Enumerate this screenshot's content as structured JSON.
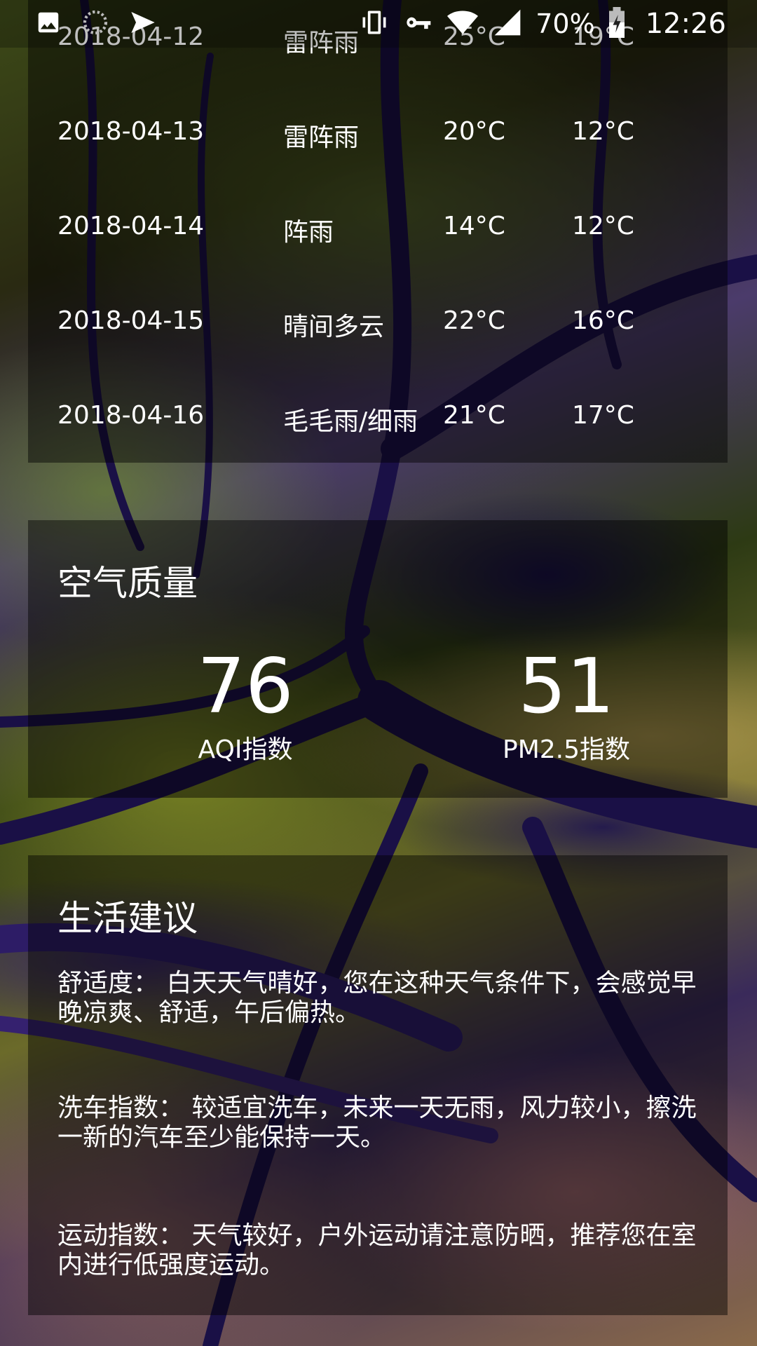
{
  "status_bar": {
    "battery": "70%",
    "time": "12:26",
    "icons": [
      "image-icon",
      "sync-icon",
      "send-icon",
      "vibrate-icon",
      "vpn-key-icon",
      "wifi-icon",
      "cell-signal-icon",
      "battery-charging-icon"
    ]
  },
  "forecast": {
    "rows": [
      {
        "date": "2018-04-12",
        "info": "雷阵雨",
        "max": "25°C",
        "min": "19°C"
      },
      {
        "date": "2018-04-13",
        "info": "雷阵雨",
        "max": "20°C",
        "min": "12°C"
      },
      {
        "date": "2018-04-14",
        "info": "阵雨",
        "max": "14°C",
        "min": "12°C"
      },
      {
        "date": "2018-04-15",
        "info": "晴间多云",
        "max": "22°C",
        "min": "16°C"
      },
      {
        "date": "2018-04-16",
        "info": "毛毛雨/细雨",
        "max": "21°C",
        "min": "17°C"
      }
    ]
  },
  "aqi": {
    "title": "空气质量",
    "aqi_value": "76",
    "aqi_label": "AQI指数",
    "pm25_value": "51",
    "pm25_label": "PM2.5指数"
  },
  "suggestion": {
    "title": "生活建议",
    "comfort": "舒适度： 白天天气晴好，您在这种天气条件下，会感觉早晚凉爽、舒适，午后偏热。",
    "car_wash": "洗车指数： 较适宜洗车，未来一天无雨，风力较小，擦洗一新的汽车至少能保持一天。",
    "sport": "运动指数： 天气较好，户外运动请注意防晒，推荐您在室内进行低强度运动。"
  },
  "colors": {
    "card_overlay": "#000000",
    "text": "#ffffff"
  }
}
